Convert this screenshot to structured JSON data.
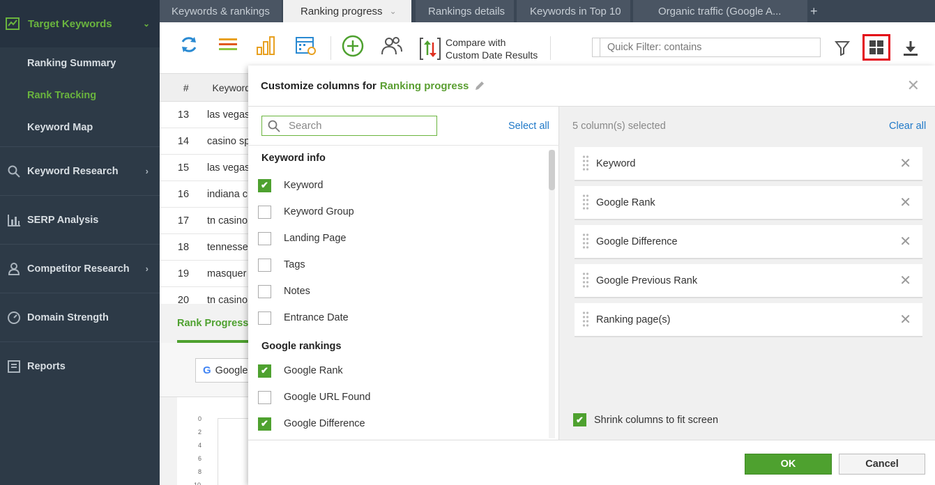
{
  "sidebar": {
    "header": "Target Keywords",
    "subitems": [
      "Ranking Summary",
      "Rank Tracking",
      "Keyword Map"
    ],
    "items": [
      "Keyword Research",
      "SERP Analysis",
      "Competitor Research",
      "Domain Strength",
      "Reports"
    ]
  },
  "tabs": [
    "Keywords & rankings",
    "Ranking progress",
    "Rankings details",
    "Keywords in Top 10",
    "Organic traffic (Google A..."
  ],
  "toolbar": {
    "compare_line1": "Compare with",
    "compare_line2": "Custom Date Results",
    "filter_placeholder": "Quick Filter: contains"
  },
  "table": {
    "headers": [
      "#",
      "Keyword"
    ],
    "rows": [
      {
        "n": "13",
        "kw": "las vegas"
      },
      {
        "n": "14",
        "kw": "casino sp"
      },
      {
        "n": "15",
        "kw": "las vegas"
      },
      {
        "n": "16",
        "kw": "indiana c"
      },
      {
        "n": "17",
        "kw": "tn casino"
      },
      {
        "n": "18",
        "kw": "tennesse"
      },
      {
        "n": "19",
        "kw": "masquer"
      },
      {
        "n": "20",
        "kw": "tn casino"
      }
    ]
  },
  "bottom": {
    "title": "Rank Progress",
    "google_label": "Google",
    "axis": [
      "0",
      "2",
      "4",
      "6",
      "8",
      "10"
    ]
  },
  "dialog": {
    "title_prefix": "Customize columns for",
    "title_name": "Ranking progress",
    "search_placeholder": "Search",
    "select_all": "Select all",
    "section1": "Keyword info",
    "keyword_info": [
      {
        "label": "Keyword",
        "checked": true
      },
      {
        "label": "Keyword Group",
        "checked": false
      },
      {
        "label": "Landing Page",
        "checked": false
      },
      {
        "label": "Tags",
        "checked": false
      },
      {
        "label": "Notes",
        "checked": false
      },
      {
        "label": "Entrance Date",
        "checked": false
      }
    ],
    "section2": "Google rankings",
    "google_rankings": [
      {
        "label": "Google Rank",
        "checked": true
      },
      {
        "label": "Google URL Found",
        "checked": false
      },
      {
        "label": "Google Difference",
        "checked": true
      }
    ],
    "selected_count": "5 column(s) selected",
    "clear_all": "Clear all",
    "selected_columns": [
      "Keyword",
      "Google Rank",
      "Google Difference",
      "Google Previous Rank",
      "Ranking page(s)"
    ],
    "shrink_label": "Shrink columns to fit screen",
    "ok": "OK",
    "cancel": "Cancel"
  }
}
